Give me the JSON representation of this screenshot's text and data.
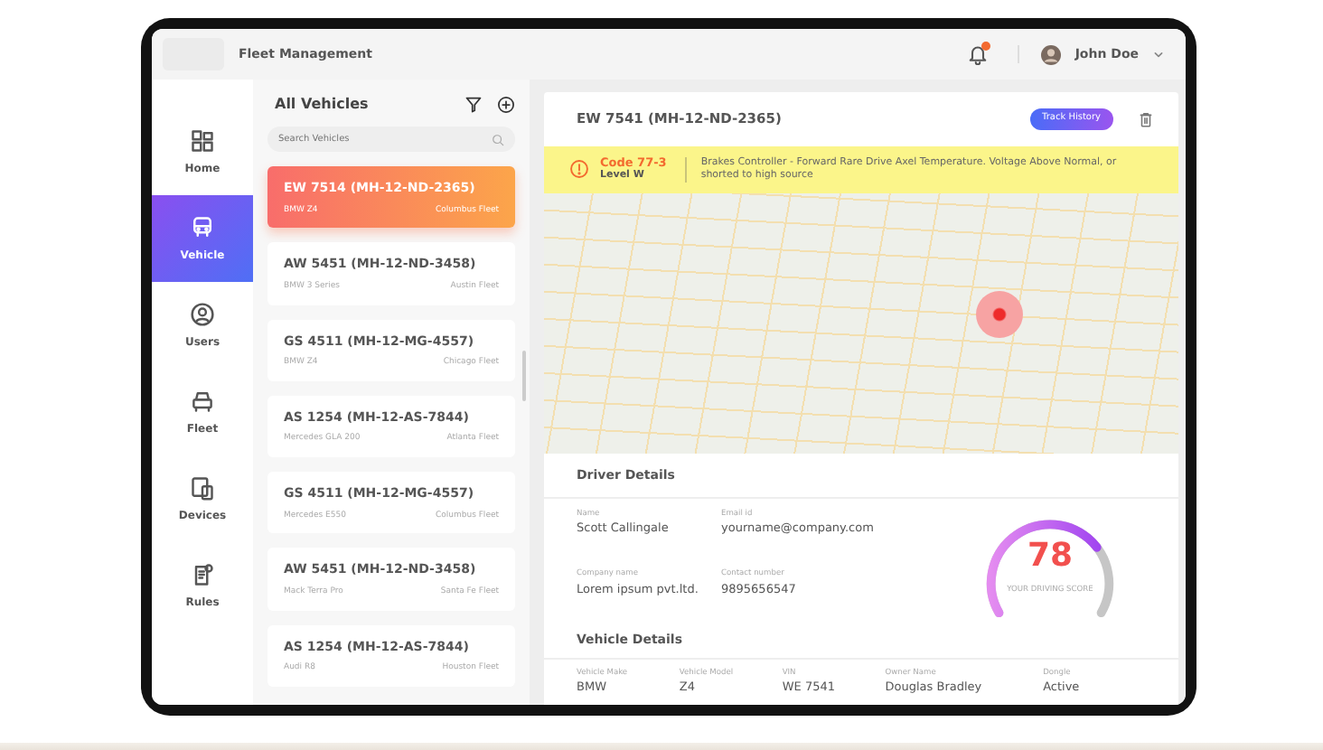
{
  "topbar": {
    "title": "Fleet Management",
    "has_notifications": true,
    "user": {
      "name": "John Doe"
    }
  },
  "nav": [
    {
      "label": "Home",
      "selected": false
    },
    {
      "label": "Vehicle",
      "selected": true
    },
    {
      "label": "Users",
      "selected": false
    },
    {
      "label": "Fleet",
      "selected": false
    },
    {
      "label": "Devices",
      "selected": false
    },
    {
      "label": "Rules",
      "selected": false
    }
  ],
  "vehicle_list": {
    "title": "All Vehicles",
    "search": {
      "placeholder": "Search Vehicles"
    },
    "vehicles": [
      {
        "title": "EW 7514 (MH-12-ND-2365)",
        "model": "BMW Z4",
        "fleet": "Columbus Fleet",
        "selected": true
      },
      {
        "title": "AW 5451 (MH-12-ND-3458)",
        "model": "BMW 3 Series",
        "fleet": "Austin Fleet",
        "selected": false
      },
      {
        "title": "GS 4511 (MH-12-MG-4557)",
        "model": "BMW Z4",
        "fleet": "Chicago Fleet",
        "selected": false
      },
      {
        "title": "AS 1254 (MH-12-AS-7844)",
        "model": "Mercedes GLA 200",
        "fleet": "Atlanta Fleet",
        "selected": false
      },
      {
        "title": "GS 4511 (MH-12-MG-4557)",
        "model": "Mercedes E550",
        "fleet": "Columbus Fleet",
        "selected": false
      },
      {
        "title": "AW 5451 (MH-12-ND-3458)",
        "model": "Mack Terra Pro",
        "fleet": "Santa Fe Fleet",
        "selected": false
      },
      {
        "title": "AS 1254 (MH-12-AS-7844)",
        "model": "Audi R8",
        "fleet": "Houston Fleet",
        "selected": false
      }
    ]
  },
  "detail": {
    "title": "EW 7541 (MH-12-ND-2365)",
    "track_button": "Track History",
    "alert": {
      "code": "Code 77-3",
      "level": "Level W",
      "message": "Brakes Controller -  Forward Rare Drive Axel Temperature. Voltage Above Normal, or shorted to high source"
    },
    "driver": {
      "heading": "Driver Details",
      "fields": [
        {
          "label": "Name",
          "value": "Scott Callingale"
        },
        {
          "label": "Email id",
          "value": "yourname@company.com"
        },
        {
          "label": "Company name",
          "value": "Lorem ipsum pvt.ltd."
        },
        {
          "label": "Contact number",
          "value": "9895656547"
        }
      ],
      "score": {
        "value": "78",
        "caption": "YOUR DRIVING SCORE"
      }
    },
    "vehicle": {
      "heading": "Vehicle Details",
      "fields": [
        {
          "label": "Vehicle Make",
          "value": "BMW"
        },
        {
          "label": "Vehicle Model",
          "value": "Z4"
        },
        {
          "label": "VIN",
          "value": "WE 7541"
        },
        {
          "label": "Owner Name",
          "value": "Douglas Bradley"
        },
        {
          "label": "Dongle",
          "value": "Active"
        }
      ]
    }
  }
}
